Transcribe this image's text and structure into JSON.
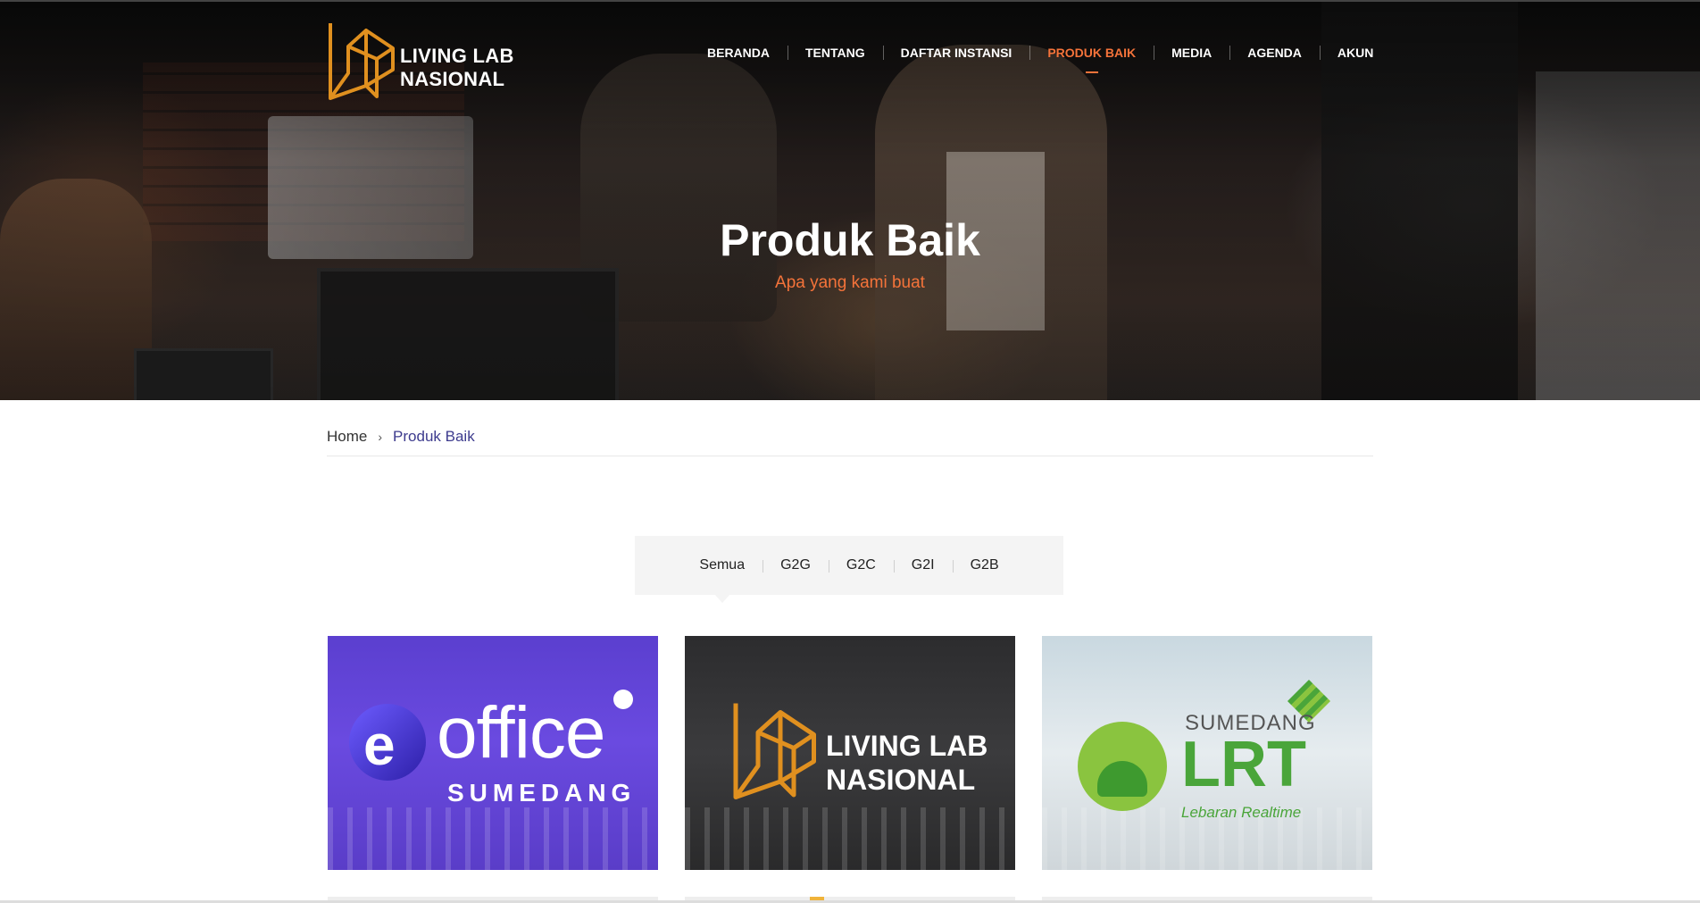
{
  "brand": {
    "name_line1": "LIVING LAB",
    "name_line2": "NASIONAL",
    "accent_color": "#f4733a",
    "logo_color": "#e0901f"
  },
  "nav": {
    "items": [
      {
        "label": "BERANDA",
        "active": false
      },
      {
        "label": "TENTANG",
        "active": false
      },
      {
        "label": "DAFTAR INSTANSI",
        "active": false
      },
      {
        "label": "PRODUK BAIK",
        "active": true
      },
      {
        "label": "MEDIA",
        "active": false
      },
      {
        "label": "AGENDA",
        "active": false
      },
      {
        "label": "AKUN",
        "active": false
      }
    ]
  },
  "hero": {
    "title": "Produk Baik",
    "subtitle": "Apa yang kami buat"
  },
  "breadcrumb": {
    "home": "Home",
    "separator": "›",
    "current": "Produk Baik"
  },
  "filter": {
    "items": [
      "Semua",
      "G2G",
      "G2C",
      "G2I",
      "G2B"
    ],
    "active": "Semua"
  },
  "products": [
    {
      "logo_text": "office",
      "logo_letter": "e",
      "logo_sub": "SUMEDANG",
      "bg_color": "#5b3fcf"
    },
    {
      "logo_line1": "LIVING LAB",
      "logo_line2": "NASIONAL",
      "bg_color": "#2c2c2e"
    },
    {
      "logo_top": "SUMEDANG",
      "logo_big": "LRT",
      "logo_sub": "Lebaran Realtime",
      "bg_color": "#c9d8e0"
    }
  ]
}
